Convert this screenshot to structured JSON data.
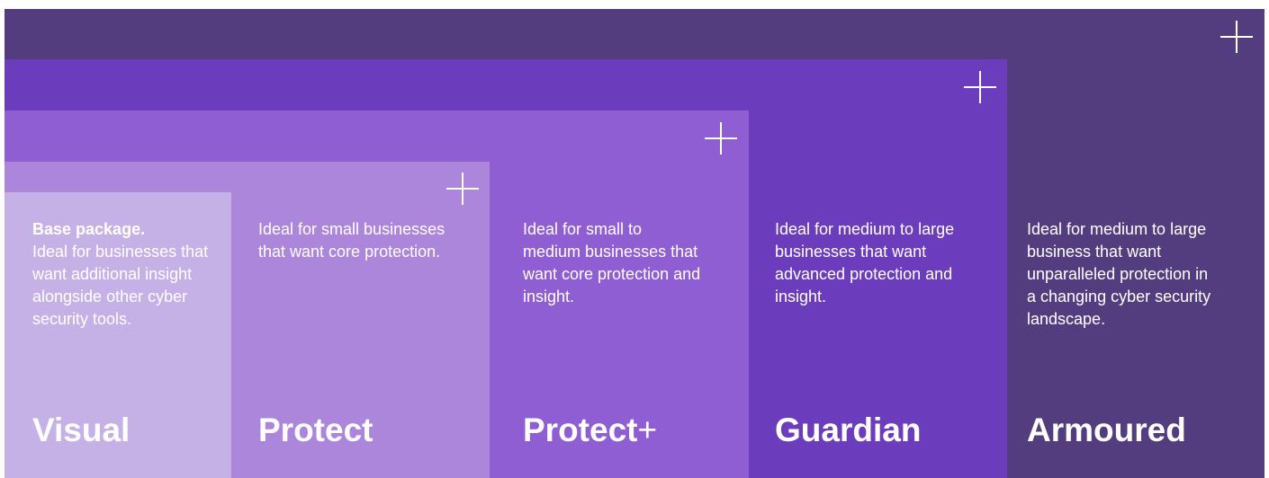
{
  "colors": {
    "armoured": "#533d7e",
    "guardian": "#6b3dbc",
    "protect_plus": "#8f5ed2",
    "protect": "#ab86db",
    "visual": "#c6b1e7",
    "text": "#ffffff"
  },
  "packages": {
    "visual": {
      "lead": "Base package.",
      "description": "Ideal for businesses that want additional insight alongside other cyber security tools.",
      "name": "Visual"
    },
    "protect": {
      "description": "Ideal for small businesses that want core protection.",
      "name": "Protect"
    },
    "protect_plus": {
      "description": "Ideal for small to medium businesses that want core protection and insight.",
      "name": "Protect",
      "suffix": "+"
    },
    "guardian": {
      "description": "Ideal for medium to large businesses that want advanced protection and insight.",
      "name": "Guardian"
    },
    "armoured": {
      "description": "Ideal for medium to large business that want unparalleled protection in a changing cyber security landscape.",
      "name": "Armoured"
    }
  },
  "icons": {
    "expand": "plus-icon"
  }
}
